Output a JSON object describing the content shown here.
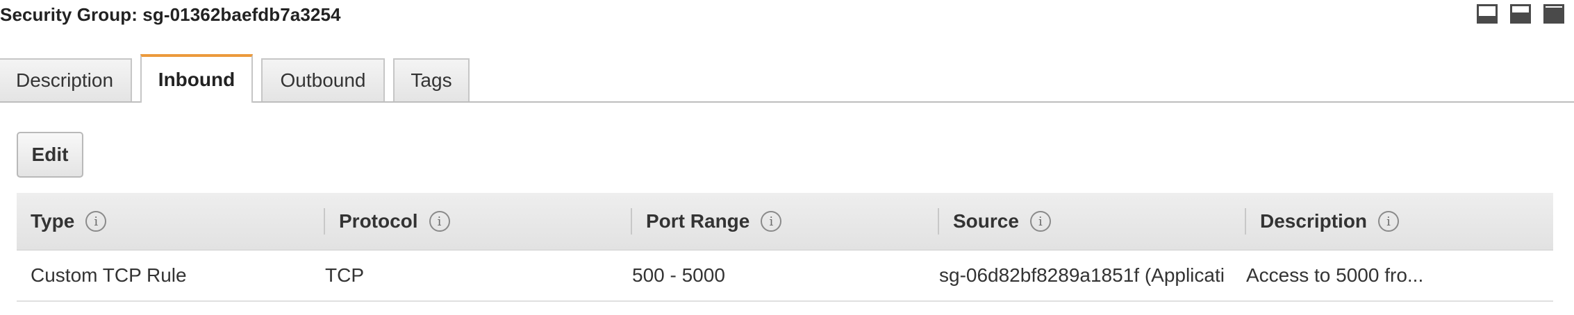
{
  "header": {
    "title": "Security Group: sg-01362baefdb7a3254",
    "layout_icons": [
      "panel-bottom-icon",
      "panel-middle-icon",
      "panel-top-icon"
    ]
  },
  "tabs": [
    {
      "label": "Description",
      "active": false
    },
    {
      "label": "Inbound",
      "active": true
    },
    {
      "label": "Outbound",
      "active": false
    },
    {
      "label": "Tags",
      "active": false
    }
  ],
  "toolbar": {
    "edit_label": "Edit"
  },
  "table": {
    "columns": [
      {
        "label": "Type",
        "info_icon": "i"
      },
      {
        "label": "Protocol",
        "info_icon": "i"
      },
      {
        "label": "Port Range",
        "info_icon": "i"
      },
      {
        "label": "Source",
        "info_icon": "i"
      },
      {
        "label": "Description",
        "info_icon": "i"
      }
    ],
    "rows": [
      {
        "type": "Custom TCP Rule",
        "protocol": "TCP",
        "port_range": "500 - 5000",
        "source": "sg-06d82bf8289a1851f (Applicati",
        "description": "Access to 5000 fro..."
      }
    ]
  },
  "colors": {
    "active_tab_accent": "#ec9a3c",
    "header_bg": "#e8e8e8",
    "text": "#333333"
  }
}
